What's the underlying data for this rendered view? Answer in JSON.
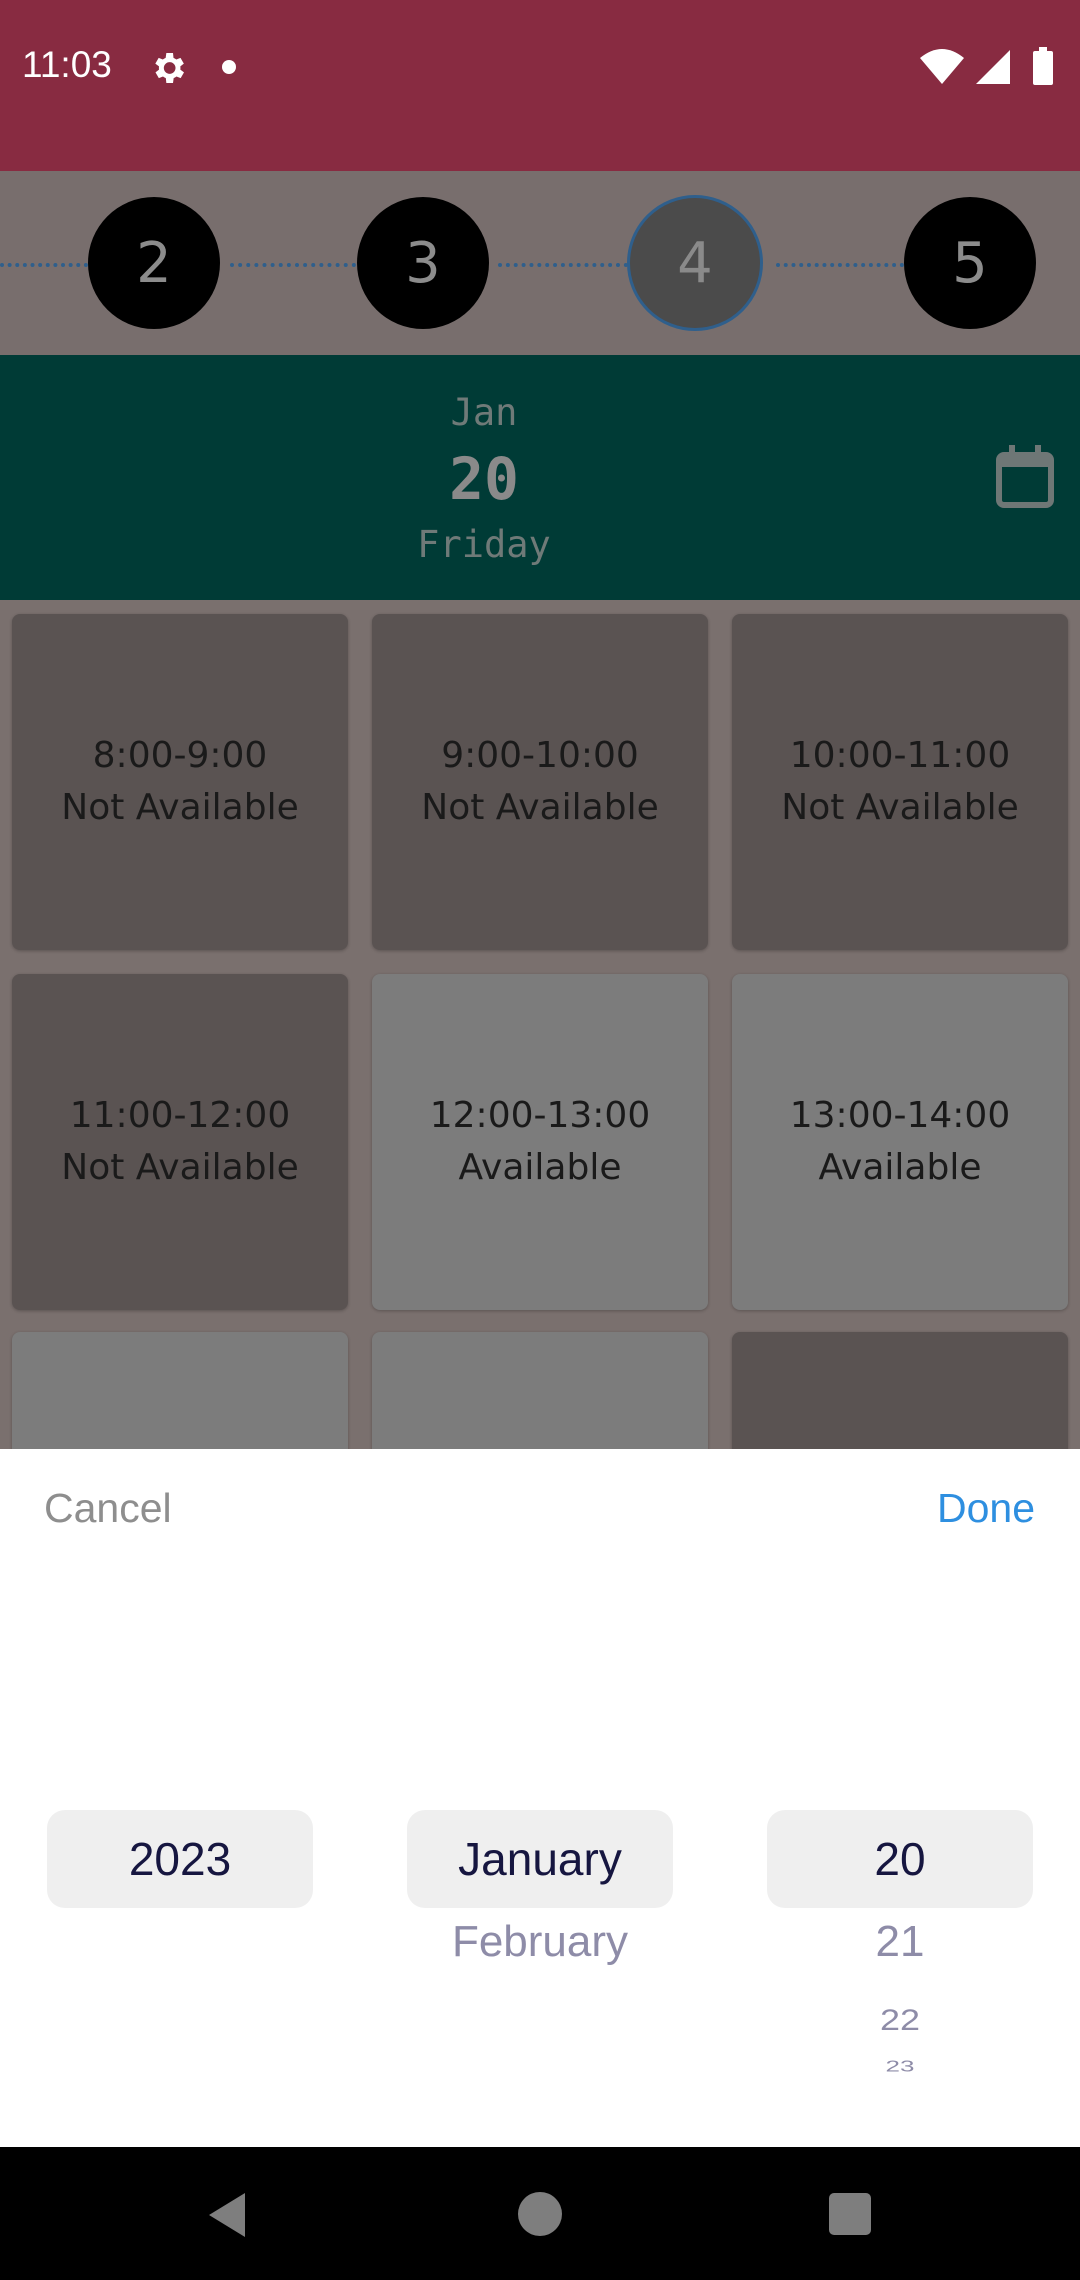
{
  "status_bar": {
    "time": "11:03",
    "icons": [
      "gear-icon",
      "notification-dot-icon",
      "wifi-icon",
      "signal-icon",
      "battery-icon"
    ],
    "background": "#882b41"
  },
  "stepper": {
    "steps": [
      "2",
      "3",
      "4",
      "5"
    ],
    "current": "4"
  },
  "date_header": {
    "month": "Jan",
    "day": "20",
    "weekday": "Friday",
    "background": "#003b36"
  },
  "slots": [
    {
      "time": "8:00-9:00",
      "status": "Not Available"
    },
    {
      "time": "9:00-10:00",
      "status": "Not Available"
    },
    {
      "time": "10:00-11:00",
      "status": "Not Available"
    },
    {
      "time": "11:00-12:00",
      "status": "Not Available"
    },
    {
      "time": "12:00-13:00",
      "status": "Available"
    },
    {
      "time": "13:00-14:00",
      "status": "Available"
    }
  ],
  "picker": {
    "cancel_label": "Cancel",
    "done_label": "Done",
    "year": {
      "selected": "2023"
    },
    "month": {
      "selected": "January",
      "next": [
        "February"
      ]
    },
    "day": {
      "selected": "20",
      "next": [
        "21",
        "22",
        "23"
      ]
    },
    "accent": "#2e8fe0"
  },
  "nav_bar": {
    "icons": [
      "back-icon",
      "home-icon",
      "recents-icon"
    ]
  }
}
